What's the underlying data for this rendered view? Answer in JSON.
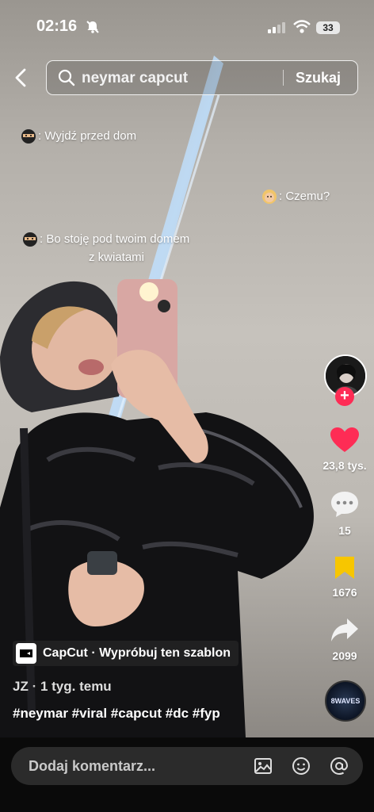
{
  "status_bar": {
    "time": "02:16",
    "battery": "33"
  },
  "search": {
    "query": "neymar capcut",
    "button": "Szukaj"
  },
  "chat": [
    {
      "emoji": "ninja",
      "text": ": Wyjdź przed dom"
    },
    {
      "emoji": "girl",
      "text": ": Czemu?"
    },
    {
      "emoji": "ninja",
      "text": ": Bo stoję pod twoim domem"
    },
    {
      "text": "z kwiatami"
    }
  ],
  "actions": {
    "likes": "23,8 tys.",
    "comments": "15",
    "saves": "1676",
    "shares": "2099"
  },
  "template_badge": {
    "label": "CapCut · Wypróbuj ten szablon"
  },
  "author": {
    "name": "JZ",
    "separator": " · ",
    "time": "1 tyg. temu"
  },
  "hashtags": "#neymar #viral #capcut #dc #fyp",
  "music_disc": {
    "label": "8WAVES"
  },
  "comment_bar": {
    "placeholder": "Dodaj komentarz..."
  },
  "colors": {
    "like": "#fe2c55",
    "save": "#f7c600",
    "follow": "#fe2c55"
  }
}
